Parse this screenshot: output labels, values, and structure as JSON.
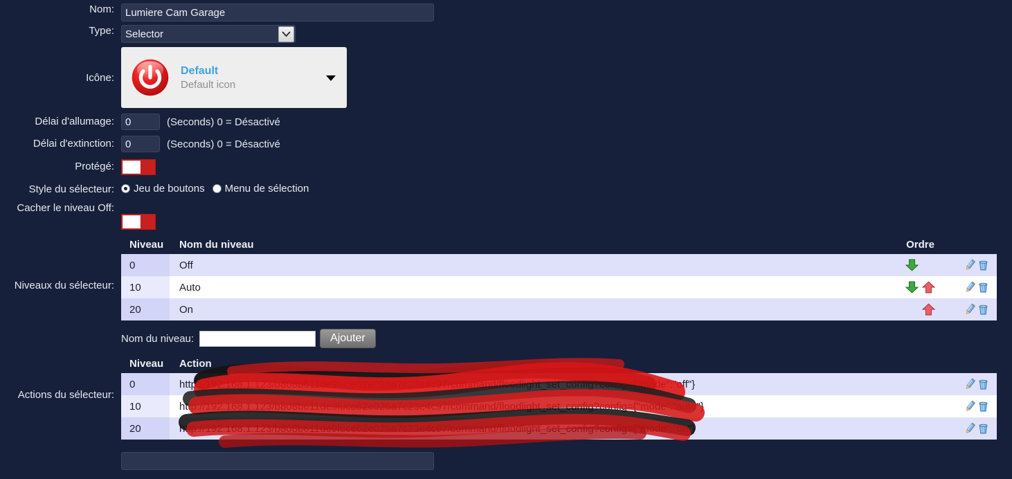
{
  "form": {
    "name_label": "Nom:",
    "name_value": "Lumiere Cam Garage",
    "type_label": "Type:",
    "type_value": "Selector",
    "icon_label": "Icône:",
    "icon_title": "Default",
    "icon_subtitle": "Default icon",
    "on_delay_label": "Délai d'allumage:",
    "on_delay_value": "0",
    "on_delay_note": "(Seconds) 0 = Désactivé",
    "off_delay_label": "Délai d'extinction:",
    "off_delay_value": "0",
    "off_delay_note": "(Seconds) 0 = Désactivé",
    "protected_label": "Protégé:",
    "selector_style_label": "Style du sélecteur:",
    "selector_style_option_1": "Jeu de boutons",
    "selector_style_option_2": "Menu de sélection",
    "selector_style_selected": "Jeu de boutons",
    "hide_off_label": "Cacher le niveau Off:",
    "levels_label": "Niveaux du sélecteur:",
    "actions_label": "Actions du sélecteur:"
  },
  "levels_table": {
    "header_level": "Niveau",
    "header_name": "Nom du niveau",
    "header_order": "Ordre",
    "rows": [
      {
        "level": "0",
        "name": "Off",
        "can_down": true,
        "can_up": false
      },
      {
        "level": "10",
        "name": "Auto",
        "can_down": true,
        "can_up": true
      },
      {
        "level": "20",
        "name": "On",
        "can_down": false,
        "can_up": true
      }
    ]
  },
  "add_level": {
    "label": "Nom du niveau:",
    "value": "",
    "button": "Ajouter"
  },
  "actions_table": {
    "header_level": "Niveau",
    "header_action": "Action",
    "rows": [
      {
        "level": "0",
        "action_prefix": "http://192.168.1.123/b8",
        "action_redacted": "08b611de9luce62e026a7c23e4",
        "action_suffix": "c97/command/floodlight_set_config?config={\"mode\":\"off\"}"
      },
      {
        "level": "10",
        "action_prefix": "http://192.168.1.123/b808b61",
        "action_redacted": "1de9luce62e026a7c23e4",
        "action_suffix": "c97/command/floodlight_set_config?config={\"mode\":\"auto\"}"
      },
      {
        "level": "20",
        "action_prefix": "http://192.168.1.123/b808b",
        "action_redacted": "611de9luce62e026a7c23e4",
        "action_suffix": "c97/command/floodlight_set_config?config={\"mode\":\"on\"}"
      }
    ]
  },
  "icons": {
    "edit": "pencil-icon",
    "delete": "trash-icon",
    "move_down": "arrow-down-icon",
    "move_up": "arrow-up-icon",
    "dropdown": "chevron-down-icon",
    "power": "power-icon"
  },
  "colors": {
    "page_background": "#16203a",
    "input_background": "#2b3550",
    "toggle_on": "#c8201f",
    "row_odd": "#dfe1fa",
    "row_even": "#ffffff",
    "level_cell_odd": "#d2d5f7",
    "accent_blue": "#3ea2e0",
    "power_red": "#e01b1b"
  }
}
